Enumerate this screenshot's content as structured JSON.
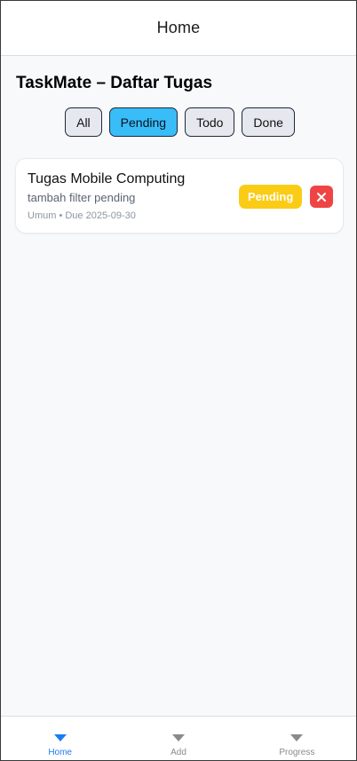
{
  "header": {
    "title": "Home"
  },
  "page": {
    "title": "TaskMate – Daftar Tugas"
  },
  "filters": {
    "options": [
      "All",
      "Pending",
      "Todo",
      "Done"
    ],
    "selected": "Pending"
  },
  "tasks": [
    {
      "title": "Tugas Mobile Computing",
      "description": "tambah filter pending",
      "meta": "Umum • Due 2025-09-30",
      "status": "Pending",
      "status_color": "#facc15",
      "delete_icon": "close-icon"
    }
  ],
  "tabbar": {
    "items": [
      {
        "label": "Home",
        "icon": "caret-down-icon",
        "active": true
      },
      {
        "label": "Add",
        "icon": "caret-down-icon",
        "active": false
      },
      {
        "label": "Progress",
        "icon": "caret-down-icon",
        "active": false
      }
    ]
  },
  "colors": {
    "accent": "#38bdf8",
    "pending": "#facc15",
    "danger": "#ef4444",
    "tab_active": "#1a7cf2"
  }
}
